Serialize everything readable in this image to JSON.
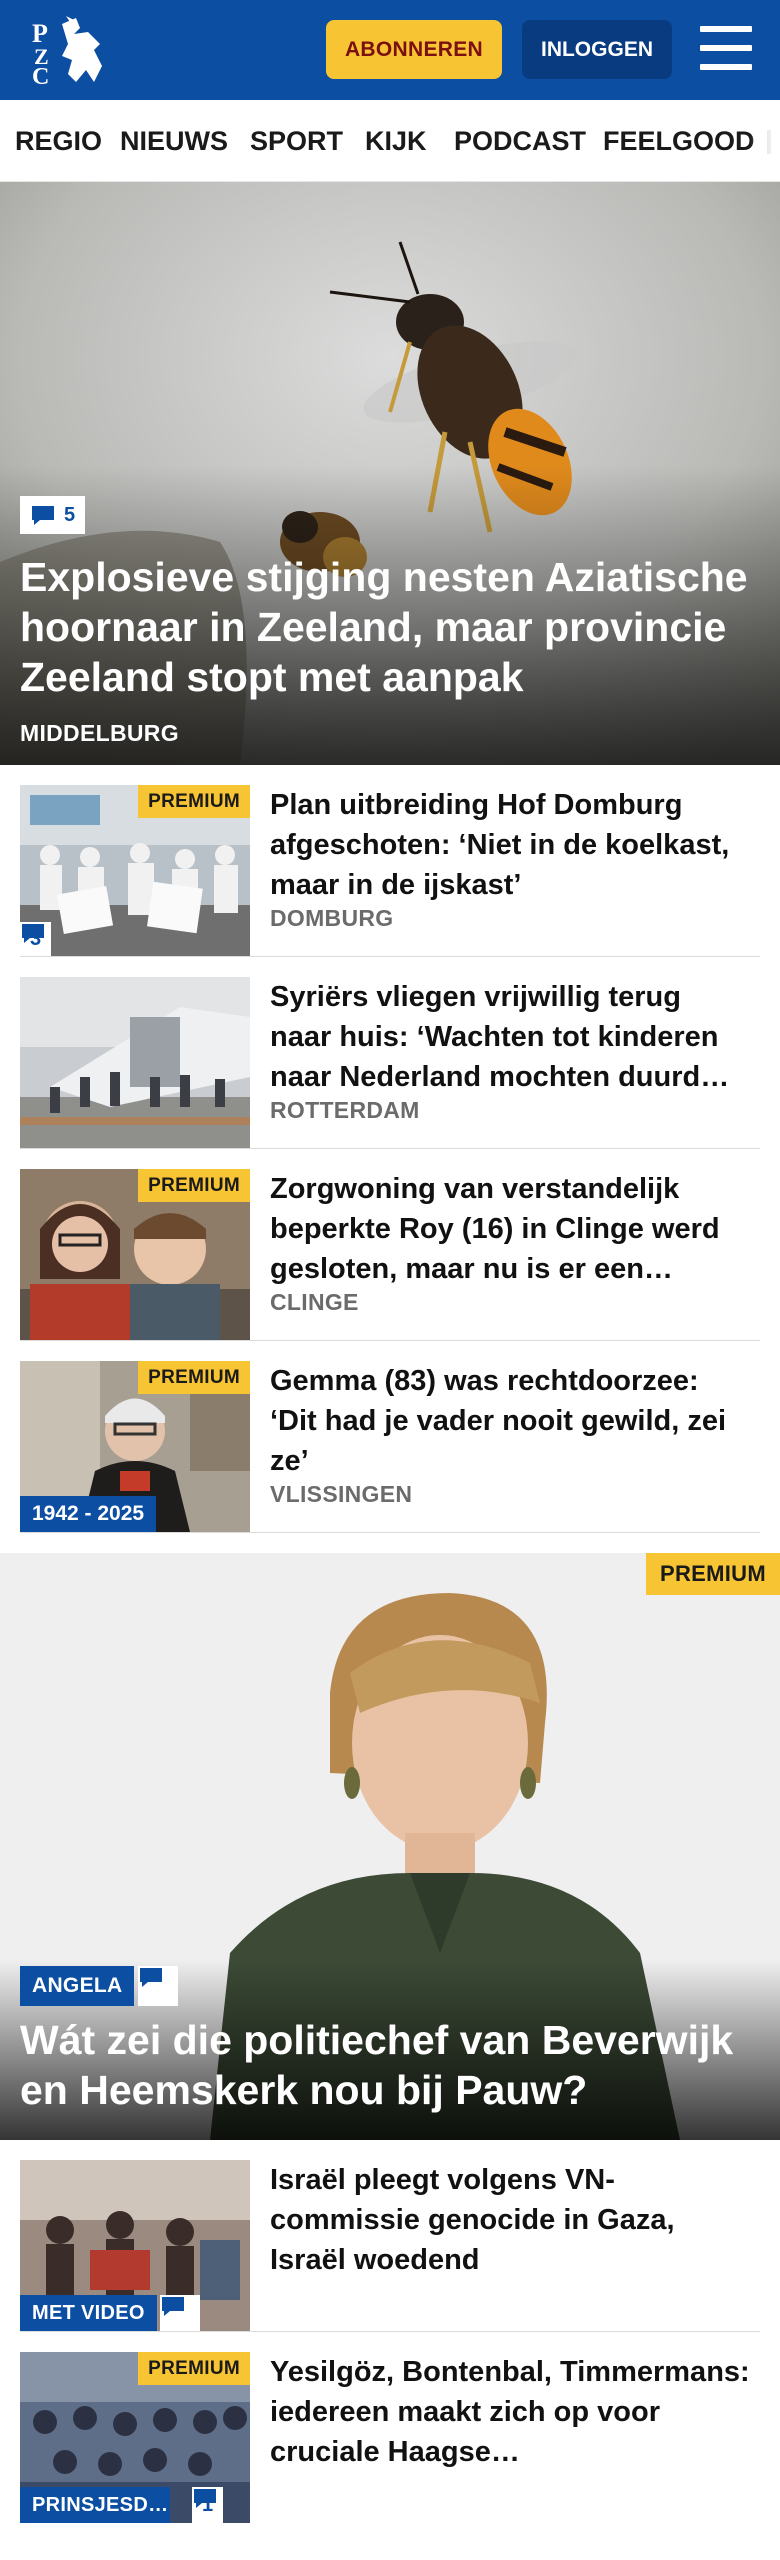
{
  "header": {
    "logo_text": "PZC",
    "subscribe_label": "ABONNEREN",
    "login_label": "INLOGGEN",
    "colors": {
      "brand": "#0b4ea2",
      "accent": "#f7c433"
    }
  },
  "nav": {
    "items": [
      "REGIO",
      "NIEUWS",
      "SPORT",
      "KIJK",
      "PODCAST",
      "FEELGOOD"
    ]
  },
  "hero": {
    "comments": "5",
    "title": "Explosieve stijging nesten Aziatische hoornaar in Zeeland, maar provincie Zeeland stopt met aanpak",
    "location": "MIDDELBURG"
  },
  "articles": [
    {
      "premium": "PREMIUM",
      "comments": "3",
      "title": "Plan uitbreiding Hof Domburg afgeschoten: ‘Niet in de koelkast, maar in de ijskast’",
      "location": "DOMBURG"
    },
    {
      "title": "Syriërs vliegen vrijwillig terug naar huis: ‘Wachten tot kinderen naar Nederland mochten duurd…",
      "location": "ROTTERDAM"
    },
    {
      "premium": "PREMIUM",
      "title": "Zorgwoning van verstandelijk beperkte Roy (16) in Clinge werd gesloten, maar nu is er een…",
      "location": "CLINGE"
    },
    {
      "premium": "PREMIUM",
      "badge": "1942 - 2025",
      "title": "Gemma (83) was rechtdoorzee: ‘Dit had je vader nooit gewild, zei ze’",
      "location": "VLISSINGEN"
    }
  ],
  "feature": {
    "premium": "PREMIUM",
    "tag": "ANGELA",
    "title": "Wát zei die politiechef van Beverwijk en Heemskerk nou bij Pauw?"
  },
  "articles2": [
    {
      "tag": "MET VIDEO",
      "title": "Israël pleegt volgens VN-commissie genocide in Gaza, Israël woedend"
    },
    {
      "premium": "PREMIUM",
      "tag": "PRINSJESD…",
      "comments": "1",
      "title": "Yesilgöz, Bontenbal, Timmermans: iedereen maakt zich op voor cruciale Haagse…"
    }
  ]
}
